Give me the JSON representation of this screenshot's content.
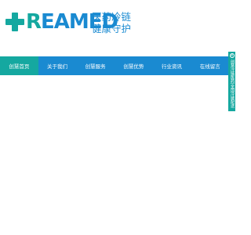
{
  "brand": {
    "logo_text_first": "R",
    "logo_text_rest": "EAMED",
    "slogan_line1": "医药冷链",
    "slogan_line2": "健康守护"
  },
  "nav": {
    "items": [
      {
        "label": "创慧首页",
        "active": true
      },
      {
        "label": "关于我们",
        "active": false
      },
      {
        "label": "创慧服务",
        "active": false
      },
      {
        "label": "创慧优势",
        "active": false
      },
      {
        "label": "行业资讯",
        "active": false
      },
      {
        "label": "在线留言",
        "active": false
      }
    ]
  },
  "side_tab": {
    "close_glyph": "×",
    "text": "创慧冷链医药|全国冷链配送"
  },
  "colors": {
    "brand_blue": "#1a8ad1",
    "brand_teal": "#15a8a0"
  }
}
